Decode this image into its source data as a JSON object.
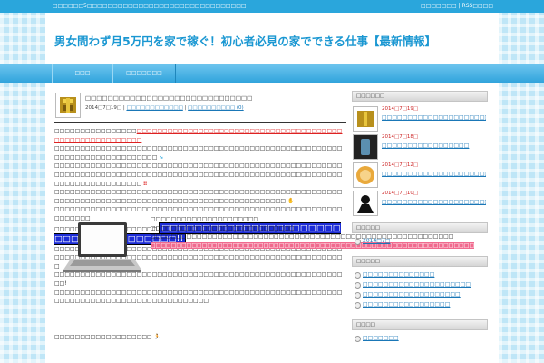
{
  "topbar": {
    "tagline": "□□□□□□5□□□□□□□□□□□□□□□□□□□□□□□□□□□□□□□",
    "links": [
      "□□□□□□□",
      "RSS□□□□"
    ]
  },
  "header": {
    "site_title": "男女問わず月5万円を家で稼ぐ！初心者必見の家でできる仕事【最新情報】"
  },
  "nav": {
    "items": [
      "□□□",
      "□□□□□□□"
    ]
  },
  "post": {
    "title": "□□□□□□□□□□□□□□□□□□□□□□□□□□□□□□",
    "meta": {
      "date": "2014□7□19□",
      "category": "□□□□□□□□□□□□",
      "comments": "□□□□□□□□□□ (0)"
    },
    "paragraphs": [
      {
        "lead": "□□□□□□□□□□□□□□□□",
        "red": "□□□□□□□□□□□□□□□□□□□□□□□□□□□□□□□□□□□□□□□□□□□□□□□□□□□□□□□□□",
        "tail": ""
      },
      {
        "lead": "□□□□□□□□□□□□□□□□□□□□□□□□□□□□□□□□□□□□□□□□□□□□□□□□□□□□□□□□□□□□□□□□□□□□□□□□□□□□",
        "red": "",
        "tail": ""
      },
      {
        "lead": "□□□□□□□□□□□□□□□□□□□□□□□□□□□□□□□□□□□□□□□□□□□□□□□□□□□□□□□□□□□□□□□□□□□□□□□□□□□□□□□□□□□□□□□□□□□□□□□□□□□□□□□□□□□□□□□□□□□□□□□□□□□□□□□□□",
        "red": "",
        "tail": ""
      },
      {
        "lead": "□□□□□□□□□□□□□□□□□□□□□□□□□□□□□□□□□□□□□□□□□□□□□□□□□□□□□□□□□□□□□□□□□□□□□□□□□□□□□□□□□□□□□□□□□□□□□□□□□□□□□",
        "red": "",
        "tail": ""
      },
      {
        "lead": "□□□□□□□□□□□□□□□□□□□□□□□□□□□□□□□□□□□□□□□□□□□□□□□□□□□□□□□□□□□□□□□",
        "red": "",
        "tail": ""
      }
    ],
    "blue_lead": "□□□□□□□□□□□□□□□□□□□□",
    "blue_highlight": "□□□□□□□□□□□□□□□□□□□□□□□□□□□□□□□□□□□□□!!",
    "paragraphs2": [
      "□□□□□□□□□□□□□□□□□□□□□□□□□□□□□□□□□□□□□□□□□□□□□□□□□□□□□□□□□□□□□□□□□□□□□□□□□□□□□□□□□□□□□□□□□□□□□□□□□□□□□□□□□□□□□□□□□",
      "□□□□□□□□□□□□□□□□□□□□□□□□□□□□□□□□□□□□□□□□□□□□□□□□□□□□□□□□□□!",
      "□□□□□□□□□□□□□□□□□□□□□□□□□□□□□□□□□□□□□□□□□□□□□□□□□□□□□□□□□□□□□□□□□□□□□□□□□□□□□□□□□□□□□□"
    ],
    "with_image": [
      "□□□□□□□□□□□□□□□□□□□□□",
      "□□□□□□□□□□□□□□□□□□□□□□□□□□□□",
      "□□□□□□□□□□□□□□□□□□□□□□□□□□□□□□□□□□□□□□□□□□□□□□□□□□□□□□□□□□□",
      "□□□□□□□□□□□□□□□□□□□□□□□□□□□□□□□□□□□□□□□□□□□□□□□□□□□□□□□□□□□□□□□"
    ],
    "after_image": "□□□□□□□□□□□□□□□□□□□"
  },
  "sidebar": {
    "recent_heading": "□□□□□□",
    "recent": [
      {
        "date": "2014□7□19□",
        "title": "□□□□□□□□□□□□□□□□□□□□□□□□□□□□□□"
      },
      {
        "date": "2014□7□18□",
        "title": "□□□□□□□□□□□□□□□□□"
      },
      {
        "date": "2014□7□12□",
        "title": "□□□□□□□□□□□□□□□□□□□□□□□□□□□□□"
      },
      {
        "date": "2014□7□10□",
        "title": "□□□□□□□□□□□□□□□□□□□□□□□□□□□□□□"
      }
    ],
    "archive_heading": "□□□□□",
    "archives": [
      "2014□7□"
    ],
    "category_heading": "□□□□□",
    "categories": [
      "□□□□□□□□□□□□□□",
      "□□□□□□□□□□□□□□□□□□□□□",
      "□□□□□□□□□□□□□□□□□□□",
      "□□□□□□□□□□□□□□□□□"
    ],
    "meta_heading": "□□□□",
    "meta": [
      "□□□□□□□"
    ]
  },
  "colors": {
    "accent_blue": "#2aa6dc",
    "title_blue": "#1a97d2",
    "link_blue": "#1a77b7",
    "red": "#dd2222",
    "highlight_blue": "#1c2cd6",
    "highlight_pink": "#f06a8e"
  }
}
